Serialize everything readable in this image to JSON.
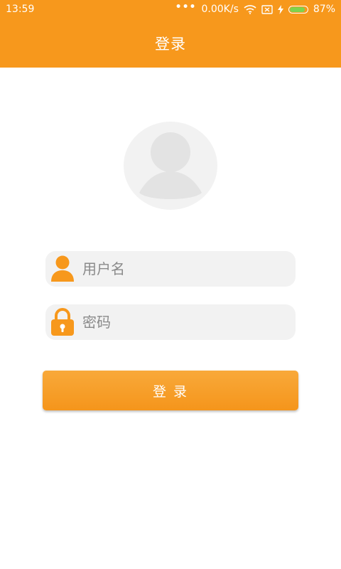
{
  "status_bar": {
    "time": "13:59",
    "dots": "•••",
    "net_speed": "0.00K/s",
    "battery": "87%",
    "battery_level": 0.87,
    "icons": [
      "wifi-icon",
      "sim-disabled-icon",
      "charging-bolt-icon",
      "battery-icon"
    ]
  },
  "header": {
    "title": "登录"
  },
  "form": {
    "username": {
      "placeholder": "用户名",
      "value": "",
      "icon": "user-icon"
    },
    "password": {
      "placeholder": "密码",
      "value": "",
      "icon": "lock-icon"
    },
    "submit_label": "登 录"
  },
  "colors": {
    "accent": "#f7981c",
    "field_bg": "#f2f2f2",
    "avatar_bg": "#f2f2f2",
    "avatar_fg": "#e3e3e3"
  }
}
